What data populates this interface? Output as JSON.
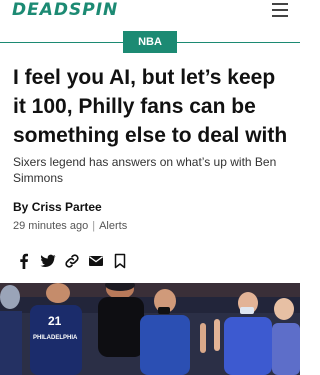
{
  "site": {
    "logo_text": "DEADSPIN",
    "menu_icon": "hamburger-menu-icon"
  },
  "colors": {
    "brand": "#1c8a73",
    "text": "#111111",
    "muted": "#555555"
  },
  "article": {
    "topic": "NBA",
    "headline": "I feel you AI, but let’s keep it 100, Philly fans can be something else to deal with",
    "dek": "Sixers legend has answers on what’s up with Ben Simmons",
    "byline_prefix": "By",
    "author": "Criss Partee",
    "time_ago": "29 minutes ago",
    "category": "Alerts",
    "jersey_number": "21",
    "jersey_text": "PHILADELPHIA"
  },
  "share_icons": [
    "facebook-icon",
    "twitter-icon",
    "link-icon",
    "email-icon",
    "bookmark-icon"
  ]
}
